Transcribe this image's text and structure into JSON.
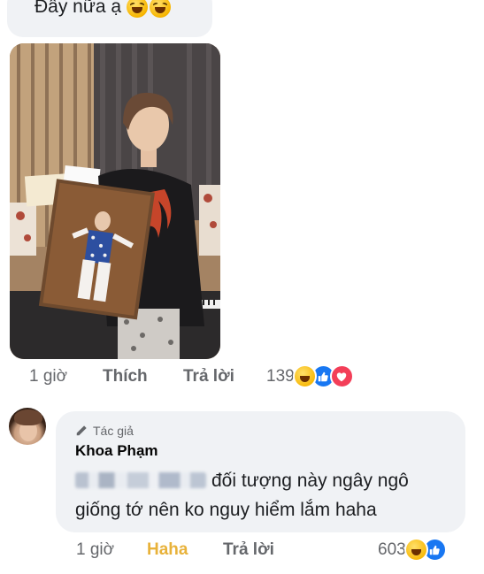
{
  "top_comment": {
    "text": "Đây nữa ạ",
    "emojis": [
      "rolling-laughing-emoji",
      "rolling-laughing-emoji"
    ]
  },
  "photo_comment": {
    "time": "1 giờ",
    "like_label": "Thích",
    "reply_label": "Trả lời",
    "reaction_count": "139",
    "reactions": [
      "haha",
      "like",
      "love"
    ]
  },
  "reply": {
    "author_badge": "Tác giả",
    "author_name": "Khoa Phạm",
    "text": "đối tượng này ngây ngô giống tớ nên ko nguy hiểm lắm haha",
    "time": "1 giờ",
    "reaction_label": "Haha",
    "reply_label": "Trả lời",
    "reaction_count": "603",
    "reactions": [
      "haha",
      "like"
    ]
  },
  "colors": {
    "bubble": "#f0f2f5",
    "meta_text": "#65676b",
    "haha_active": "#e8b23a",
    "like_blue": "#1877f2",
    "love_red": "#f33e58"
  }
}
